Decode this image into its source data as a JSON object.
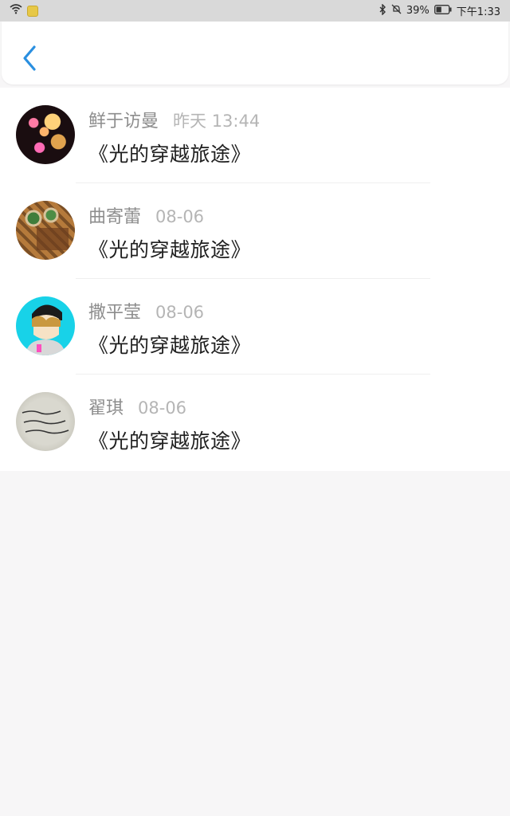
{
  "status_bar": {
    "battery": "39%",
    "time": "下午1:33"
  },
  "header": {
    "back_icon": "chevron-left-icon",
    "accent_color": "#2a8fe0"
  },
  "messages": [
    {
      "name": "鲜于访曼",
      "time": "昨天 13:44",
      "title": "《光的穿越旅途》"
    },
    {
      "name": "曲寄蕾",
      "time": "08-06",
      "title": "《光的穿越旅途》"
    },
    {
      "name": "撒平莹",
      "time": "08-06",
      "title": "《光的穿越旅途》"
    },
    {
      "name": "翟琪",
      "time": "08-06",
      "title": "《光的穿越旅途》"
    }
  ]
}
